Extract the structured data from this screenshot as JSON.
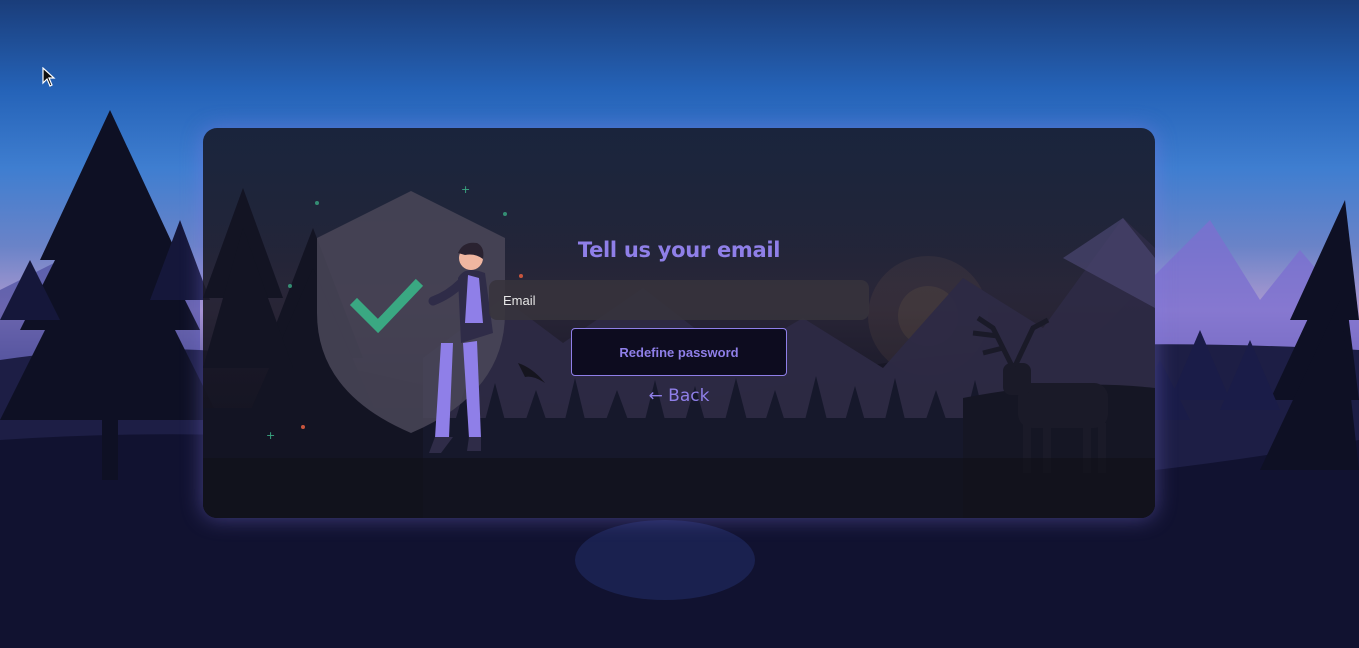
{
  "form": {
    "title": "Tell us your email",
    "email_placeholder": "Email",
    "email_value": "",
    "submit_label": "Redefine password",
    "back_label": "← Back"
  },
  "colors": {
    "accent": "#8f7fe8",
    "check": "#3aa882",
    "button_bg": "#0d0c1f"
  },
  "icons": {
    "cursor": "mouse-pointer-icon",
    "check": "checkmark-icon",
    "shield": "shield-icon"
  }
}
